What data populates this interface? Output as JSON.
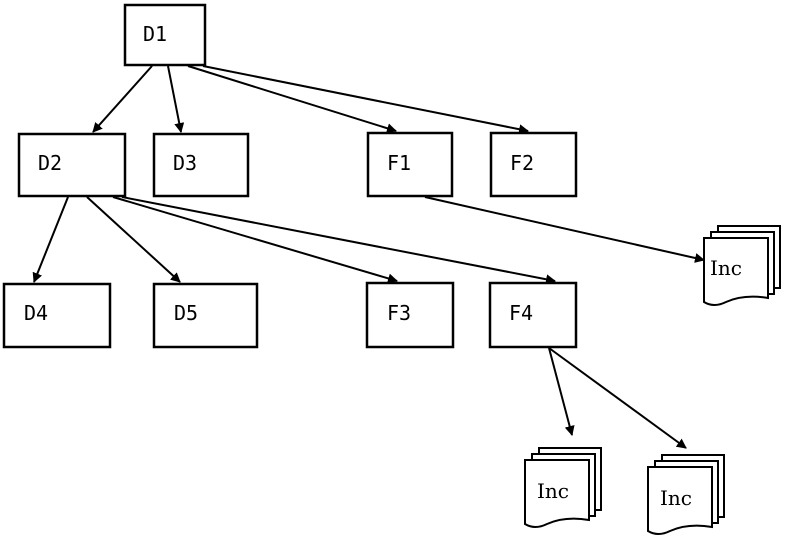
{
  "diagram": {
    "nodes": [
      {
        "id": "D1",
        "label": "D1",
        "kind": "directory"
      },
      {
        "id": "D2",
        "label": "D2",
        "kind": "directory"
      },
      {
        "id": "D3",
        "label": "D3",
        "kind": "directory"
      },
      {
        "id": "F1",
        "label": "F1",
        "kind": "file"
      },
      {
        "id": "F2",
        "label": "F2",
        "kind": "file"
      },
      {
        "id": "D4",
        "label": "D4",
        "kind": "directory"
      },
      {
        "id": "D5",
        "label": "D5",
        "kind": "directory"
      },
      {
        "id": "F3",
        "label": "F3",
        "kind": "file"
      },
      {
        "id": "F4",
        "label": "F4",
        "kind": "file"
      },
      {
        "id": "Inc1",
        "label": "Inc",
        "kind": "document-stack"
      },
      {
        "id": "Inc2",
        "label": "Inc",
        "kind": "document-stack"
      },
      {
        "id": "Inc3",
        "label": "Inc",
        "kind": "document-stack"
      }
    ],
    "edges": [
      {
        "from": "D1",
        "to": "D2"
      },
      {
        "from": "D1",
        "to": "D3"
      },
      {
        "from": "D1",
        "to": "F1"
      },
      {
        "from": "D1",
        "to": "F2"
      },
      {
        "from": "D2",
        "to": "D4"
      },
      {
        "from": "D2",
        "to": "D5"
      },
      {
        "from": "D2",
        "to": "F3"
      },
      {
        "from": "D2",
        "to": "F4"
      },
      {
        "from": "F1",
        "to": "Inc1"
      },
      {
        "from": "F4",
        "to": "Inc2"
      },
      {
        "from": "F4",
        "to": "Inc3"
      }
    ]
  }
}
